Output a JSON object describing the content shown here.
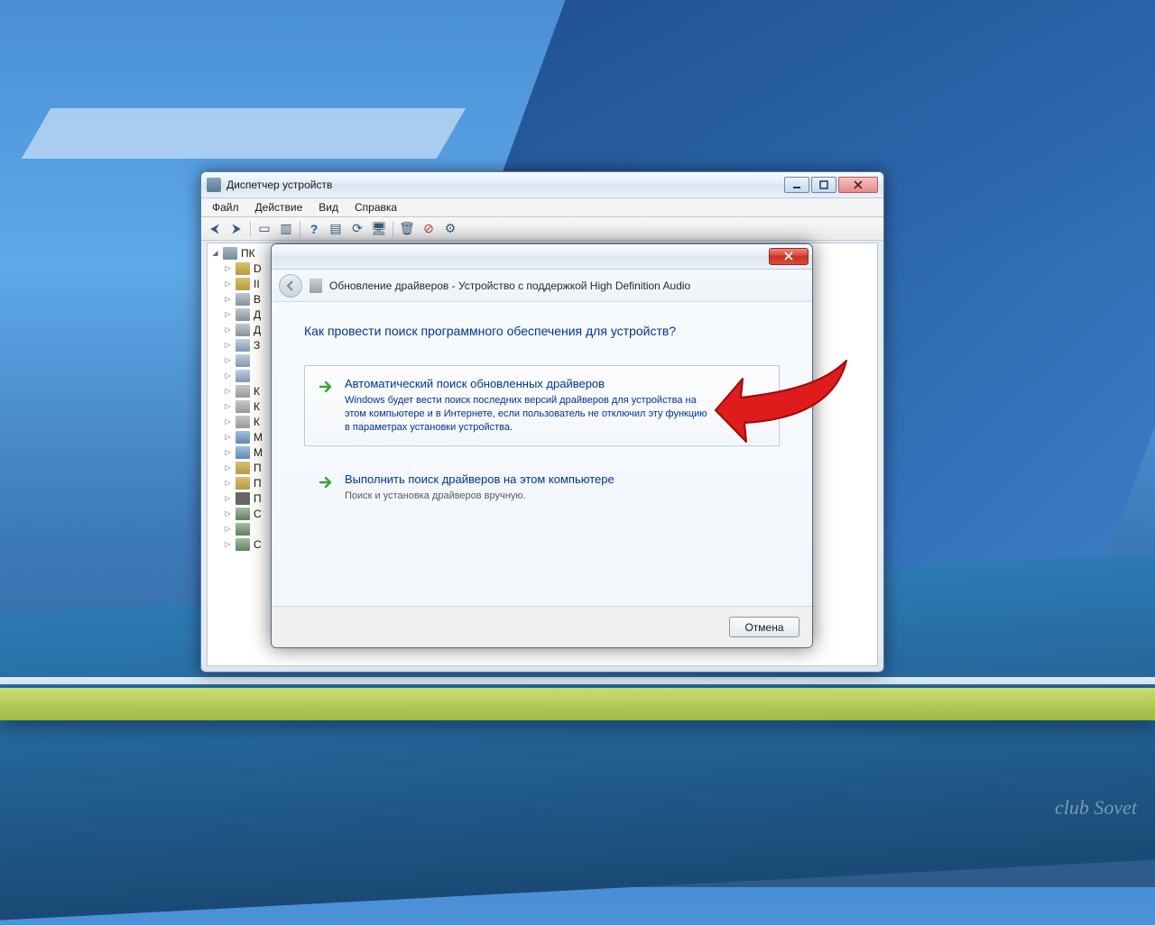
{
  "watermark": "club Sovet",
  "devmgr": {
    "title": "Диспетчер устройств",
    "menu": {
      "file": "Файл",
      "action": "Действие",
      "view": "Вид",
      "help": "Справка"
    },
    "tree": {
      "root": "ПК",
      "items": [
        "D",
        "II",
        "B",
        "Д",
        "Д",
        "З",
        "",
        "",
        "К",
        "К",
        "К",
        "М",
        "М",
        "П",
        "П",
        "П",
        "С",
        "",
        "С"
      ]
    }
  },
  "wizard": {
    "title": "Обновление драйверов - Устройство с поддержкой High Definition Audio",
    "question": "Как провести поиск программного обеспечения для устройств?",
    "option1": {
      "title": "Автоматический поиск обновленных драйверов",
      "desc": "Windows будет вести поиск последних версий драйверов для устройства на этом компьютере и в Интернете, если пользователь не отключил эту функцию в параметрах установки устройства."
    },
    "option2": {
      "title": "Выполнить поиск драйверов на этом компьютере",
      "desc": "Поиск и установка драйверов вручную."
    },
    "cancel": "Отмена"
  }
}
